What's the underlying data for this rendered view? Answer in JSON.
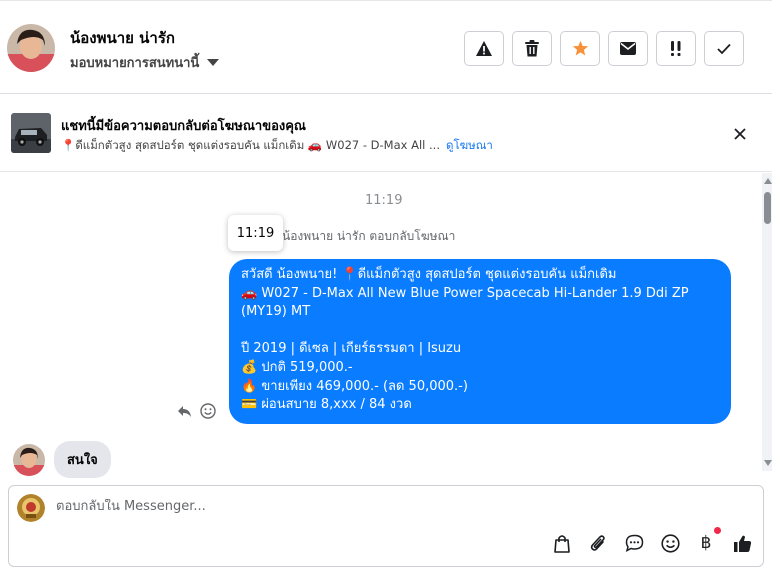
{
  "header": {
    "contact_name": "น้องพนาย น่ารัก",
    "assign_label": "มอบหมายการสนทนานี้",
    "actions": [
      {
        "icon": "warning-icon"
      },
      {
        "icon": "trash-icon"
      },
      {
        "icon": "star-icon",
        "color": "#f7923a"
      },
      {
        "icon": "mail-icon"
      },
      {
        "icon": "follow-up-icon"
      },
      {
        "icon": "check-icon"
      }
    ]
  },
  "ad_banner": {
    "title": "แชทนี้มีข้อความตอบกลับต่อโฆษณาของคุณ",
    "description": "📍ดีแม็กตัวสูง สุดสปอร์ต ชุดแต่งรอบคัน แม็กเดิม 🚗 W027 - D-Max All ...",
    "link_label": "ดูโฆษณา"
  },
  "conversation": {
    "timestamp": "11:19",
    "tooltip_time": "11:19",
    "reply_note": "น้องพนาย น่ารัก ตอบกลับโฆษณา",
    "outgoing_message": {
      "lines": [
        "สวัสดี น้องพนาย! 📍ดีแม็กตัวสูง สุดสปอร์ต ชุดแต่งรอบคัน แม็กเดิม",
        "🚗 W027 - D-Max All New Blue Power Spacecab Hi-Lander 1.9 Ddi ZP (MY19) MT",
        "",
        "ปี 2019 | ดีเซล | เกียร์ธรรมดา | Isuzu",
        "💰 ปกติ 519,000.-",
        "🔥 ขายเพียง 469,000.- (ลด 50,000.-)",
        "💳 ผ่อนสบาย 8,xxx / 84 งวด"
      ]
    },
    "incoming_message": "สนใจ"
  },
  "composer": {
    "placeholder": "ตอบกลับใน Messenger...",
    "tools": [
      "bag-icon",
      "paperclip-icon",
      "saved-reply-icon",
      "emoji-icon",
      "baht-icon",
      "thumbs-up-icon"
    ],
    "baht_symbol": "฿"
  },
  "colors": {
    "accent": "#0a7cff",
    "link": "#1877f2",
    "star": "#f7923a",
    "notification_dot": "#f02849"
  }
}
